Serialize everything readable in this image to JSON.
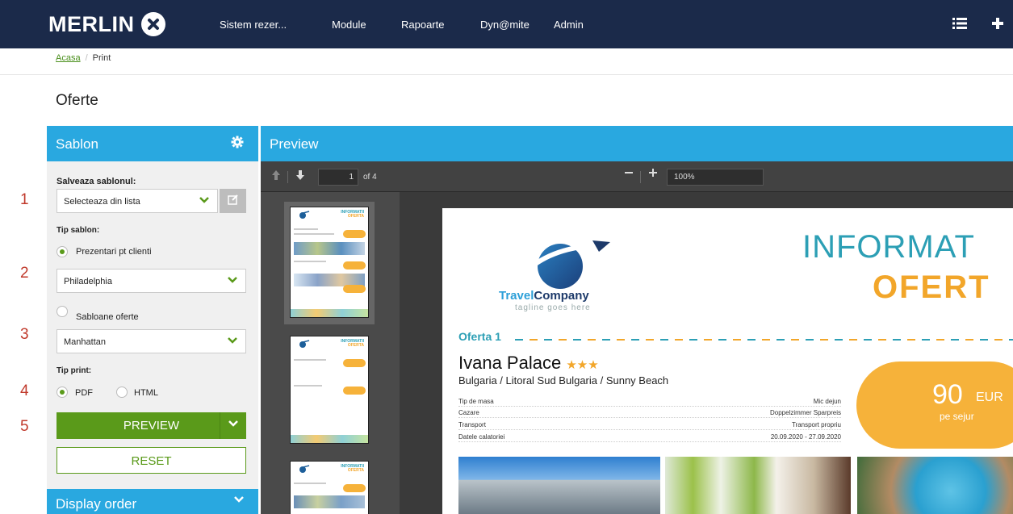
{
  "app": {
    "logo": "MERLIN"
  },
  "nav": {
    "items": [
      "Sistem rezer...",
      "Module",
      "Rapoarte",
      "Dyn@mite",
      "Admin"
    ],
    "list_icon": "list-icon",
    "plus_icon": "plus-icon"
  },
  "breadcrumb": {
    "home": "Acasa",
    "current": "Print"
  },
  "page": {
    "title": "Oferte"
  },
  "sablon": {
    "header": "Sablon",
    "save_label": "Salveaza sablonul:",
    "save_select": "Selecteaza din lista",
    "tip_sablon_label": "Tip sablon:",
    "option_clients": "Prezentari pt clienti",
    "clients_select": "Philadelphia",
    "option_offers": "Sabloane oferte",
    "offers_select": "Manhattan",
    "tip_print_label": "Tip print:",
    "print_pdf": "PDF",
    "print_html": "HTML",
    "preview_btn": "PREVIEW",
    "reset_btn": "RESET",
    "display_order": "Display order"
  },
  "annotations": [
    "1",
    "2",
    "3",
    "4",
    "5"
  ],
  "preview": {
    "header": "Preview",
    "page_number": "1",
    "page_of": "of 4",
    "zoom": "100%"
  },
  "document": {
    "brand_a": "Travel",
    "brand_b": "Company",
    "tagline": "tagline goes here",
    "title_line1": "INFORMAT",
    "title_line2": "OFERT",
    "offer_label": "Oferta 1",
    "hotel": "Ivana Palace",
    "stars": "★★★",
    "location": "Bulgaria / Litoral Sud Bulgaria / Sunny Beach",
    "details": [
      {
        "k": "Tip de masa",
        "v": "Mic dejun"
      },
      {
        "k": "Cazare",
        "v": "Doppelzimmer Sparpreis"
      },
      {
        "k": "Transport",
        "v": "Transport propriu"
      },
      {
        "k": "Datele calatoriei",
        "v": "20.09.2020 - 27.09.2020"
      }
    ],
    "price": "90",
    "currency": "EUR",
    "price_note": "pe sejur"
  },
  "thumbs": {
    "t1": "INFORMATII",
    "t2": "OFERTA"
  }
}
